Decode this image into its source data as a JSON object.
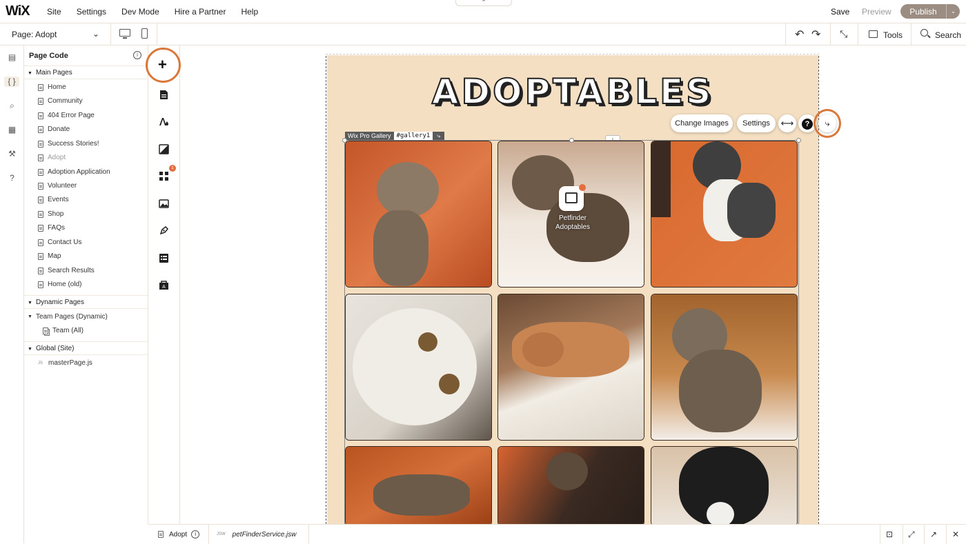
{
  "topbar": {
    "logo": "WiX",
    "menu": [
      "Site",
      "Settings",
      "Dev Mode",
      "Hire a Partner",
      "Help"
    ],
    "collapse": "⌃",
    "save": "Save",
    "preview": "Preview",
    "publish": "Publish",
    "publish_arrow": "⌄"
  },
  "secondbar": {
    "page_label": "Page: Adopt",
    "chevron": "⌄",
    "undo": "↶",
    "redo": "↷",
    "fit": "⤡",
    "tools": "Tools",
    "search": "Search"
  },
  "rail": {
    "icons": [
      "pages-icon",
      "code-icon",
      "search-icon",
      "database-icon",
      "wrench-icon",
      "help-icon"
    ],
    "glyphs": [
      "▤",
      "{ }",
      "⌕",
      "▦",
      "⚒",
      "?"
    ]
  },
  "code_panel": {
    "title": "Page Code",
    "info": "i",
    "main_pages_label": "Main Pages",
    "main_pages": [
      "Home",
      "Community",
      "404 Error Page",
      "Donate",
      "Success Stories!",
      "Adopt",
      "Adoption Application",
      "Volunteer",
      "Events",
      "Shop",
      "FAQs",
      "Contact Us",
      "Map",
      "Search Results",
      "Home (old)"
    ],
    "active_page": "Adopt",
    "dynamic_pages_label": "Dynamic Pages",
    "team_pages_label": "Team Pages (Dynamic)",
    "team_all": "Team (All)",
    "global_label": "Global (Site)",
    "master_page": "masterPage.js",
    "js_tag": "JS"
  },
  "add_strip": {
    "plus": "+",
    "badge": "1"
  },
  "canvas": {
    "site_title": "ADOPTABLES",
    "gallery_type": "Wix Pro Gallery",
    "gallery_id": "#gallery1",
    "gallery_icon": "⤷",
    "download": "⤓",
    "change_images": "Change Images",
    "settings": "Settings",
    "stretch": "⟷",
    "help": "?",
    "connect": "⤷",
    "app_name": "Petfinder Adoptables",
    "colors": {
      "background": "#f4dfc2",
      "accent": "#d9783a",
      "orange": "#d96a35"
    }
  },
  "bottombar": {
    "page_tab": "Adopt",
    "info": "i",
    "file_tag": "JSW",
    "file_name": "petFinderService.jsw"
  }
}
